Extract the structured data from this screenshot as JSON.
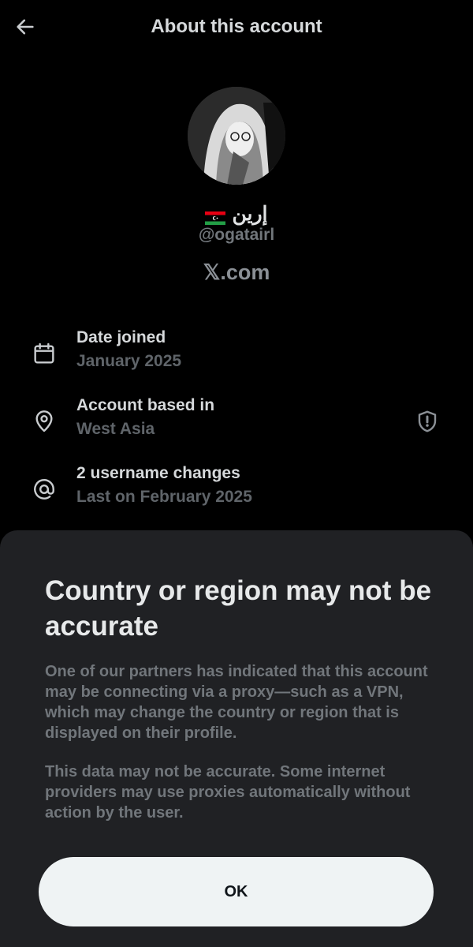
{
  "header": {
    "back_icon": "arrow-left-icon",
    "title": "About this account"
  },
  "profile": {
    "display_name": "إرين",
    "flag_icon": "flag-emoji-icon",
    "handle": "@ogatairl",
    "domain": "𝕏.com"
  },
  "info_rows": [
    {
      "icon": "calendar-icon",
      "title": "Date joined",
      "subtitle": "January 2025"
    },
    {
      "icon": "location-pin-icon",
      "title": "Account based in",
      "subtitle": "West Asia",
      "trailing_icon": "shield-alert-icon"
    },
    {
      "icon": "at-sign-icon",
      "title": "2 username changes",
      "subtitle": "Last on February 2025"
    }
  ],
  "sheet": {
    "title": "Country or region may not be accurate",
    "paragraph_1": "One of our partners has indicated that this account may be connecting via a proxy—such as a VPN, which may change the country or region that is displayed on their profile.",
    "paragraph_2": "This data may not be accurate. Some internet providers may use proxies automatically without action by the user.",
    "ok_label": "OK"
  },
  "colors": {
    "background": "#000000",
    "sheet_background": "#202124",
    "primary_text": "#e7e9ea",
    "secondary_text": "#71767b",
    "button_background": "#eff3f4"
  }
}
